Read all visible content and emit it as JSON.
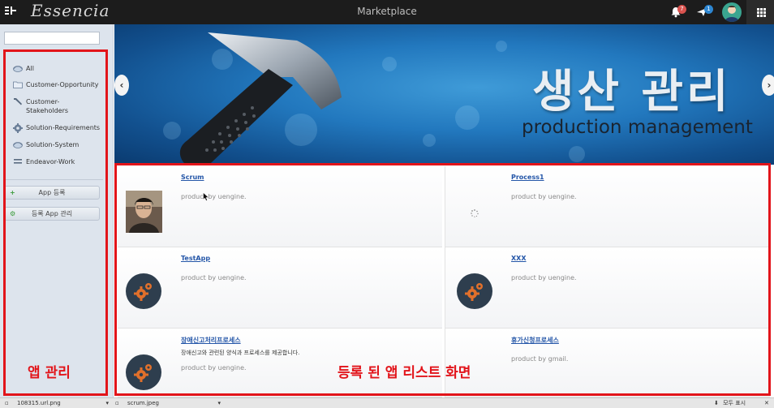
{
  "app": {
    "brand": "Essencia",
    "title": "Marketplace",
    "notifications": {
      "count": "7"
    },
    "messages": {
      "count": "1"
    }
  },
  "sidebar": {
    "search": {
      "placeholder": "",
      "value": ""
    },
    "items": [
      {
        "label": "All",
        "icon": "folder-icon"
      },
      {
        "label": "Customer-Opportunity",
        "icon": "folder-icon"
      },
      {
        "label": "Customer-\nStakeholders",
        "icon": "wrench-icon"
      },
      {
        "label": "Solution-Requirements",
        "icon": "gear-icon"
      },
      {
        "label": "Solution-System",
        "icon": "folder-icon"
      },
      {
        "label": "Endeavor-Work",
        "icon": "list-icon"
      }
    ],
    "buttons": [
      {
        "label": "App 등록",
        "icon": "plus-icon"
      },
      {
        "label": "등록 App 관리",
        "icon": "gear-icon"
      }
    ]
  },
  "banner": {
    "title": "생산 관리",
    "subtitle": "production management"
  },
  "apps": [
    {
      "title": "Scrum",
      "description": "",
      "byline": "product by uengine."
    },
    {
      "title": "Process1",
      "description": "",
      "byline": "product by uengine."
    },
    {
      "title": "TestApp",
      "description": "",
      "byline": "product by uengine."
    },
    {
      "title": "XXX",
      "description": "",
      "byline": "product by uengine."
    },
    {
      "title": "장애신고처리프로세스",
      "description": "장애신고와 관련된 양식과 프로세스를 제공합니다.",
      "byline": "product by uengine."
    },
    {
      "title": "휴가신청프로세스",
      "description": "",
      "byline": "product by gmail."
    }
  ],
  "annotations": {
    "sidebar_label": "앱 관리",
    "list_label": "등록 된 앱 리스트 화면"
  },
  "downloads": {
    "items": [
      {
        "name": "108315.url.png"
      },
      {
        "name": "scrum.jpeg"
      }
    ],
    "show_all": "모두 표시"
  },
  "colors": {
    "accent_red": "#e2141a",
    "topbar": "#1c1c1c",
    "link": "#2456a8"
  }
}
